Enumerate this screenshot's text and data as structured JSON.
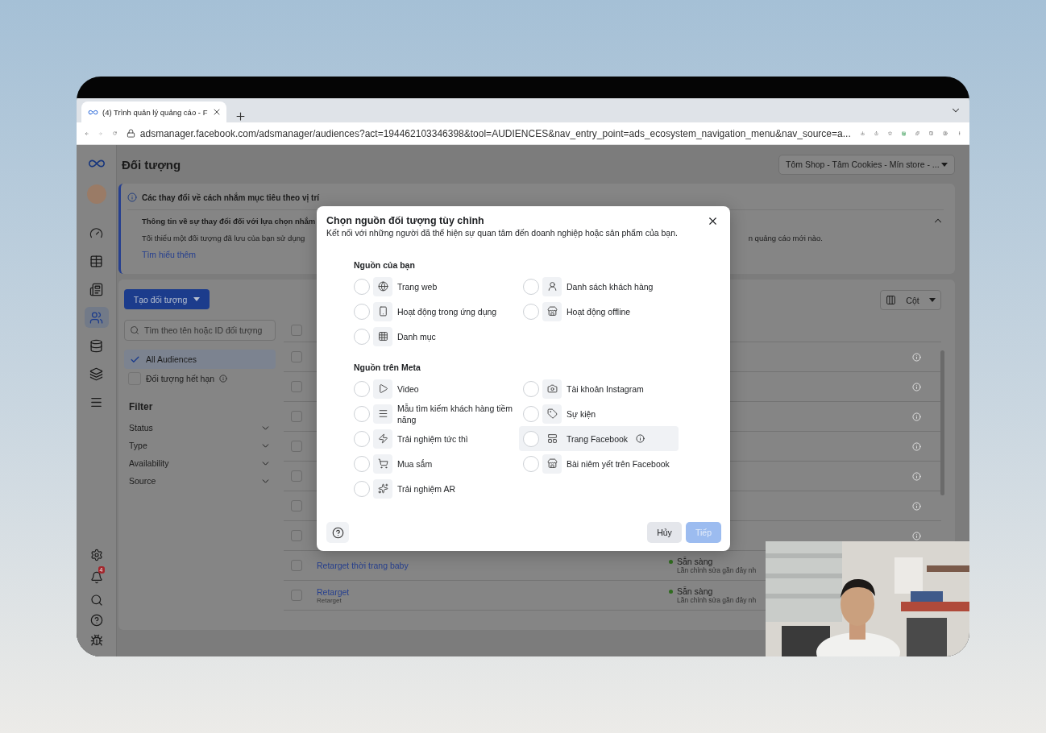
{
  "browser": {
    "tab_title": "(4) Trình quản lý quảng cáo - F",
    "url": "adsmanager.facebook.com/adsmanager/audiences?act=194462103346398&tool=AUDIENCES&nav_entry_point=ads_ecosystem_navigation_menu&nav_source=a..."
  },
  "nav": {
    "items": [
      {
        "selected": false
      },
      {
        "selected": false
      },
      {
        "selected": false
      },
      {
        "selected": true
      },
      {
        "selected": false
      },
      {
        "selected": false
      },
      {
        "selected": false
      }
    ],
    "notification_badge": "4"
  },
  "page": {
    "title": "Đối tượng",
    "account": "Tôm Shop - Tâm Cookies - Mín store - ..."
  },
  "banner": {
    "heading": "Các thay đổi về cách nhắm mục tiêu theo vị trí",
    "subheading": "Thông tin về sự thay đổi đối với lựa chọn nhắm",
    "body_start": "Tối thiểu một đối tượng đã lưu của bạn sử dụng",
    "body_end": "n quảng cáo mới nào.",
    "link": "Tìm hiểu thêm",
    "expanded": true
  },
  "sidebar": {
    "create_button": "Tạo đối tượng",
    "search_placeholder": "Tìm theo tên hoặc ID đối tượng",
    "views": [
      {
        "label": "All Audiences",
        "checked": true
      },
      {
        "label": "Đối tượng hết hạn",
        "checked": false,
        "info_icon": true
      }
    ],
    "filter_title": "Filter",
    "filters": [
      {
        "label": "Status",
        "expanded": false
      },
      {
        "label": "Type",
        "expanded": false
      },
      {
        "label": "Availability",
        "expanded": false
      },
      {
        "label": "Source",
        "expanded": false
      }
    ]
  },
  "columns_button": "Cột",
  "table": {
    "header_checked": false,
    "rows": [
      {
        "checked": false
      },
      {
        "checked": false
      },
      {
        "checked": false
      },
      {
        "checked": false
      },
      {
        "checked": false
      },
      {
        "checked": false
      },
      {
        "checked": false
      },
      {
        "checked": false,
        "name": "Retarget thời trang baby",
        "status": "Sẵn sàng",
        "status_note": "Lần chỉnh sửa gần đây nh"
      },
      {
        "checked": false,
        "name": "Retarget",
        "subtitle": "Retarget",
        "status": "Sẵn sàng",
        "status_note": "Lần chỉnh sửa gần đây nh"
      }
    ]
  },
  "dialog": {
    "title": "Chọn nguồn đối tượng tùy chỉnh",
    "subtitle": "Kết nối với những người đã thể hiện sự quan tâm đến doanh nghiệp hoặc sản phẩm của bạn.",
    "sections": [
      {
        "title": "Nguồn của bạn",
        "columns": [
          [
            {
              "label": "Trang web",
              "selected": false,
              "highlighted": false
            },
            {
              "label": "Hoạt động trong ứng dụng",
              "selected": false,
              "highlighted": false
            },
            {
              "label": "Danh mục",
              "selected": false,
              "highlighted": false
            }
          ],
          [
            {
              "label": "Danh sách khách hàng",
              "selected": false,
              "highlighted": false
            },
            {
              "label": "Hoạt động offline",
              "selected": false,
              "highlighted": false
            }
          ]
        ]
      },
      {
        "title": "Nguồn trên Meta",
        "columns": [
          [
            {
              "label": "Video",
              "selected": false,
              "highlighted": false
            },
            {
              "label": "Mẫu tìm kiếm khách hàng tiềm năng",
              "selected": false,
              "highlighted": false
            },
            {
              "label": "Trải nghiệm tức thì",
              "selected": false,
              "highlighted": false
            },
            {
              "label": "Mua sắm",
              "selected": false,
              "highlighted": false
            },
            {
              "label": "Trải nghiệm AR",
              "selected": false,
              "highlighted": false
            }
          ],
          [
            {
              "label": "Tài khoản Instagram",
              "selected": false,
              "highlighted": false
            },
            {
              "label": "Sự kiện",
              "selected": false,
              "highlighted": false
            },
            {
              "label": "Trang Facebook",
              "selected": false,
              "highlighted": true,
              "info_icon": true
            },
            {
              "label": "Bài niêm yết trên Facebook",
              "selected": false,
              "highlighted": false
            }
          ]
        ]
      }
    ],
    "cancel": "Hủy",
    "next": {
      "label": "Tiếp",
      "disabled": true
    }
  }
}
